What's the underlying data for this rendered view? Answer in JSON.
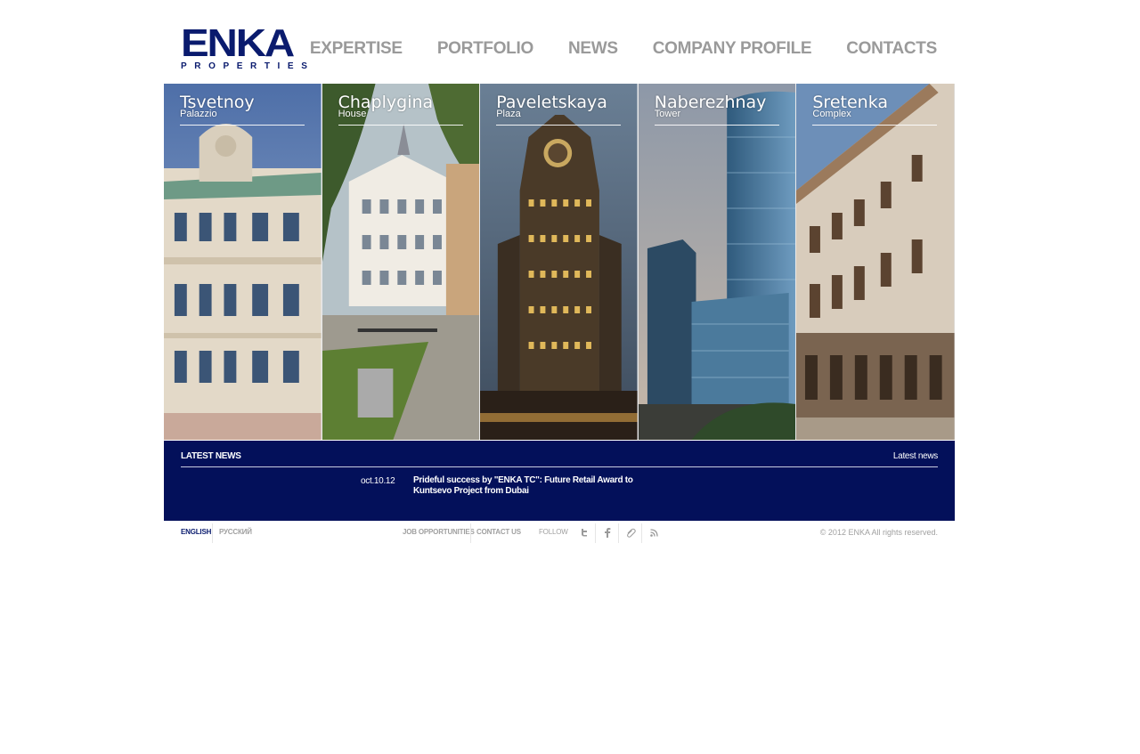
{
  "header": {
    "logo_main": "ENKA",
    "logo_sub": "PROPERTIES",
    "nav": [
      "EXPERTISE",
      "PORTFOLIO",
      "NEWS",
      "COMPANY PROFILE",
      "CONTACTS"
    ]
  },
  "projects": [
    {
      "name": "Tsvetnoy",
      "type": "Palazzio"
    },
    {
      "name": "Chaplygina",
      "type": "House"
    },
    {
      "name": "Paveletskaya",
      "type": "Plaza"
    },
    {
      "name": "Naberezhnay",
      "type": "Tower"
    },
    {
      "name": "Sretenka",
      "type": "Complex"
    }
  ],
  "news": {
    "title": "LATEST NEWS",
    "link": "Latest news",
    "date": "oct.10.12",
    "headline": "Prideful success by \"ENKA TC\": Future Retail Award to Kuntsevo Project from Dubai"
  },
  "footer": {
    "lang_en": "ENGLISH",
    "lang_ru": "РУССКИЙ",
    "job": "JOB OPPORTUNITIES",
    "contact": "CONTACT US",
    "follow": "FOLLOW",
    "social": [
      "twitter-icon",
      "facebook-icon",
      "attachment-icon",
      "rss-icon"
    ],
    "copyright": "© 2012 ENKA All rights reserved."
  },
  "colors": {
    "brand": "#0a1b6e",
    "news_bg": "#03105a",
    "nav_text": "#9a9a9a"
  }
}
